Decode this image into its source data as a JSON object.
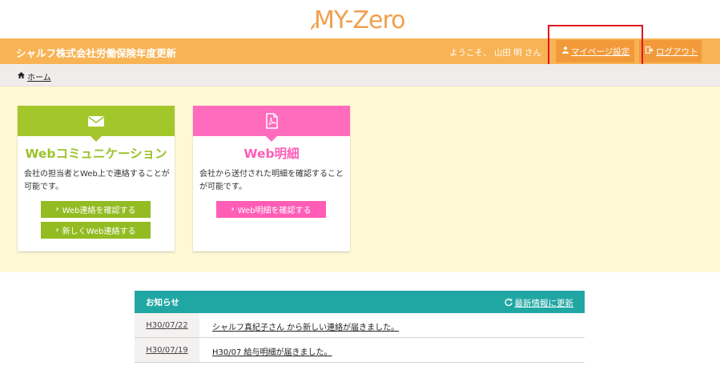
{
  "logo": {
    "text": "MY-Zero"
  },
  "header": {
    "company": "シャルフ株式会社労働保険年度更新",
    "welcome": "ようこそ、 山田 明 さん",
    "mypage_label": "マイページ設定",
    "logout_label": "ログアウト",
    "color": "#f8b354"
  },
  "breadcrumb": {
    "home": "ホーム"
  },
  "cards": [
    {
      "title": "Webコミュニケーション",
      "description": "会社の担当者とWeb上で連絡することが可能です。",
      "icon": "envelope-icon",
      "color": "#a3c72b",
      "buttons": [
        "Web連絡を確認する",
        "新しくWeb連絡する"
      ]
    },
    {
      "title": "Web明細",
      "description": "会社から送付された明細を確認することが可能です。",
      "icon": "pdf-file-icon",
      "color": "#ff6cbd",
      "buttons": [
        "Web明細を確認する"
      ]
    }
  ],
  "news": {
    "title": "お知らせ",
    "refresh_label": "最新情報に更新",
    "color": "#21a7a3",
    "items": [
      {
        "date": "H30/07/22",
        "text": "シャルフ真紀子さん から新しい連絡が届きました。"
      },
      {
        "date": "H30/07/19",
        "text": "H30/07 給与明細が届きました。"
      }
    ]
  }
}
